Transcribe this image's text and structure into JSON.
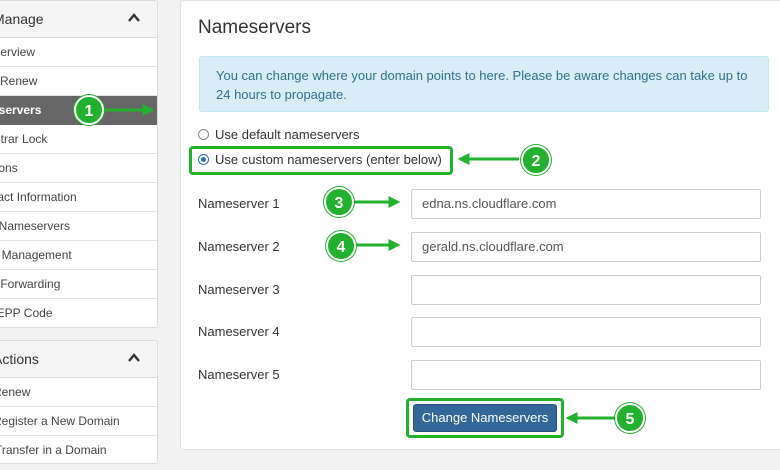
{
  "sidebar": {
    "manage": {
      "title": "Manage",
      "items": [
        {
          "label": "Overview",
          "active": false
        },
        {
          "label": "Auto Renew",
          "active": false
        },
        {
          "label": "Nameservers",
          "active": true
        },
        {
          "label": "Registrar Lock",
          "active": false
        },
        {
          "label": "Addons",
          "active": false
        },
        {
          "label": "Contact Information",
          "active": false
        },
        {
          "label": "Private Nameservers",
          "active": false
        },
        {
          "label": "DNS Management",
          "active": false
        },
        {
          "label": "Email Forwarding",
          "active": false
        },
        {
          "label": "Get EPP Code",
          "active": false
        }
      ]
    },
    "actions": {
      "title": "Actions",
      "items": [
        {
          "label": "Renew"
        },
        {
          "label": "Register a New Domain"
        },
        {
          "label": "Transfer in a Domain"
        }
      ]
    }
  },
  "main": {
    "title": "Nameservers",
    "info_alert": "You can change where your domain points to here. Please be aware changes can take up to 24 hours to propagate.",
    "radio_default": "Use default nameservers",
    "radio_custom": "Use custom nameservers (enter below)",
    "nameservers": [
      {
        "label": "Nameserver 1",
        "value": "edna.ns.cloudflare.com"
      },
      {
        "label": "Nameserver 2",
        "value": "gerald.ns.cloudflare.com"
      },
      {
        "label": "Nameserver 3",
        "value": ""
      },
      {
        "label": "Nameserver 4",
        "value": ""
      },
      {
        "label": "Nameserver 5",
        "value": ""
      }
    ],
    "submit_label": "Change Nameservers"
  },
  "annotations": {
    "badge_1": "1",
    "badge_2": "2",
    "badge_3": "3",
    "badge_4": "4",
    "badge_5": "5",
    "color": "#22b12e"
  },
  "colors": {
    "button_bg": "#336699",
    "active_item_bg": "#666666",
    "alert_bg": "#d9edf7",
    "alert_text": "#31708f"
  },
  "icons": {
    "collapse": "chevron-up-icon"
  }
}
